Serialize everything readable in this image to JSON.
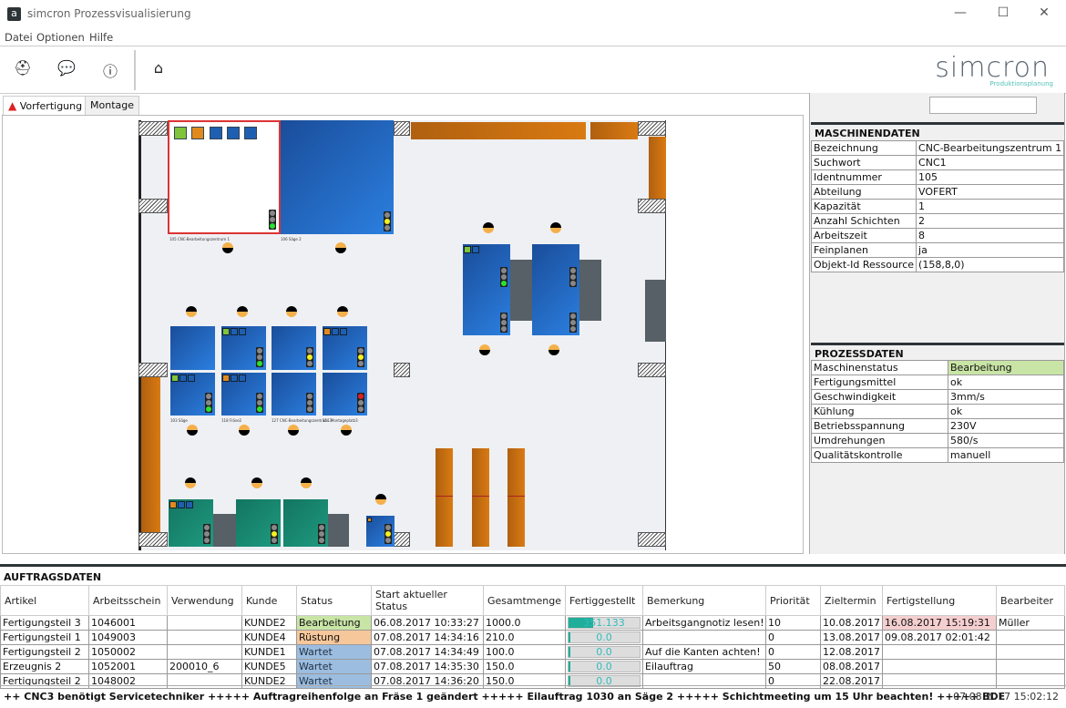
{
  "window": {
    "title": "simcron Prozessvisualisierung",
    "app_icon": "a",
    "minimize": "—",
    "maximize": "☐",
    "close": "✕"
  },
  "menu": [
    "Datei",
    "Optionen",
    "Hilfe"
  ],
  "toolbar": {
    "icons": [
      "operator-icon",
      "chat-icon",
      "help-icon",
      "home-icon"
    ]
  },
  "logo": {
    "name": "simcron",
    "tagline": "Produktionsplanung"
  },
  "tabs": [
    {
      "label": "Vorfertigung",
      "warning": true
    },
    {
      "label": "Montage"
    }
  ],
  "search": {
    "value": ""
  },
  "maschinendaten": {
    "title": "MASCHINENDATEN",
    "rows": [
      [
        "Bezeichnung",
        "CNC-Bearbeitungszentrum 1"
      ],
      [
        "Suchwort",
        "CNC1"
      ],
      [
        "Identnummer",
        "105"
      ],
      [
        "Abteilung",
        "VOFERT"
      ],
      [
        "Kapazität",
        "1"
      ],
      [
        "Anzahl Schichten",
        "2"
      ],
      [
        "Arbeitszeit",
        "8"
      ],
      [
        "Feinplanen",
        "ja"
      ],
      [
        "Objekt-Id Ressource",
        "(158,8,0)"
      ]
    ]
  },
  "prozessdaten": {
    "title": "PROZESSDATEN",
    "rows": [
      [
        "Maschinenstatus",
        "Bearbeitung"
      ],
      [
        "Fertigungsmittel",
        "ok"
      ],
      [
        "Geschwindigkeit",
        "3mm/s"
      ],
      [
        "Kühlung",
        "ok"
      ],
      [
        "Betriebsspannung",
        "230V"
      ],
      [
        "Umdrehungen",
        "580/s"
      ],
      [
        "Qualitätskontrolle",
        "manuell"
      ]
    ]
  },
  "auftragsdaten": {
    "title": "AUFTRAGSDATEN",
    "columns": [
      "Artikel",
      "Arbeitsschein",
      "Verwendung",
      "Kunde",
      "Status",
      "Start aktueller Status",
      "Gesamtmenge",
      "Fertiggestellt",
      "Bemerkung",
      "Priorität",
      "Zieltermin",
      "Fertigstellung",
      "Bearbeiter"
    ],
    "rows": [
      {
        "artikel": "Fertigungsteil 3",
        "arbeitsschein": "1046001",
        "verwendung": "",
        "kunde": "KUNDE2",
        "status": "Bearbeitung",
        "start": "06.08.2017 10:33:27",
        "gesamt": "1000.0",
        "fertig": "351.133",
        "fertig_pct": 35,
        "bemerkung": "Arbeitsgangnotiz lesen!",
        "prio": "10",
        "ziel": "10.08.2017",
        "fertigstellung": "16.08.2017 15:19:31",
        "late": true,
        "bearbeiter": "Müller"
      },
      {
        "artikel": "Fertigungsteil 1",
        "arbeitsschein": "1049003",
        "verwendung": "",
        "kunde": "KUNDE4",
        "status": "Rüstung",
        "start": "07.08.2017 14:34:16",
        "gesamt": "210.0",
        "fertig": "0.0",
        "fertig_pct": 0,
        "bemerkung": "",
        "prio": "0",
        "ziel": "13.08.2017",
        "fertigstellung": "09.08.2017 02:01:42",
        "late": false,
        "bearbeiter": ""
      },
      {
        "artikel": "Fertigungsteil 2",
        "arbeitsschein": "1050002",
        "verwendung": "",
        "kunde": "KUNDE1",
        "status": "Wartet",
        "start": "07.08.2017 14:34:49",
        "gesamt": "100.0",
        "fertig": "0.0",
        "fertig_pct": 0,
        "bemerkung": "Auf die Kanten achten!",
        "prio": "0",
        "ziel": "12.08.2017",
        "fertigstellung": "",
        "late": false,
        "bearbeiter": ""
      },
      {
        "artikel": "Erzeugnis 2",
        "arbeitsschein": "1052001",
        "verwendung": "200010_6",
        "kunde": "KUNDE5",
        "status": "Wartet",
        "start": "07.08.2017 14:35:30",
        "gesamt": "150.0",
        "fertig": "0.0",
        "fertig_pct": 0,
        "bemerkung": "Eilauftrag",
        "prio": "50",
        "ziel": "08.08.2017",
        "fertigstellung": "",
        "late": false,
        "bearbeiter": ""
      },
      {
        "artikel": "Fertigungsteil 2",
        "arbeitsschein": "1048002",
        "verwendung": "",
        "kunde": "KUNDE2",
        "status": "Wartet",
        "start": "07.08.2017 14:36:20",
        "gesamt": "150.0",
        "fertig": "0.0",
        "fertig_pct": 0,
        "bemerkung": "",
        "prio": "0",
        "ziel": "22.08.2017",
        "fertigstellung": "",
        "late": false,
        "bearbeiter": ""
      }
    ]
  },
  "ticker": {
    "text": "++  CNC3 benötigt Servicetechniker   +++++   Auftragreihenfolge an Fräse 1 geändert   +++++   Eilauftrag 1030 an Säge 2   +++++   Schichtmeeting um 15 Uhr beachten!   +++++   BDE",
    "clock": "07.08.2017 15:02:12"
  },
  "floor": {
    "labels": {
      "sel": "105 CNC-Bearbeitungszentrum 1",
      "saege2": "106 Säge 2",
      "saege": "103 Säge",
      "fraese2": "118 Fräse2",
      "cnc3": "127 CNC-Bearbeitungszentrum 3",
      "mont3": "111 Montageplatz3"
    }
  }
}
